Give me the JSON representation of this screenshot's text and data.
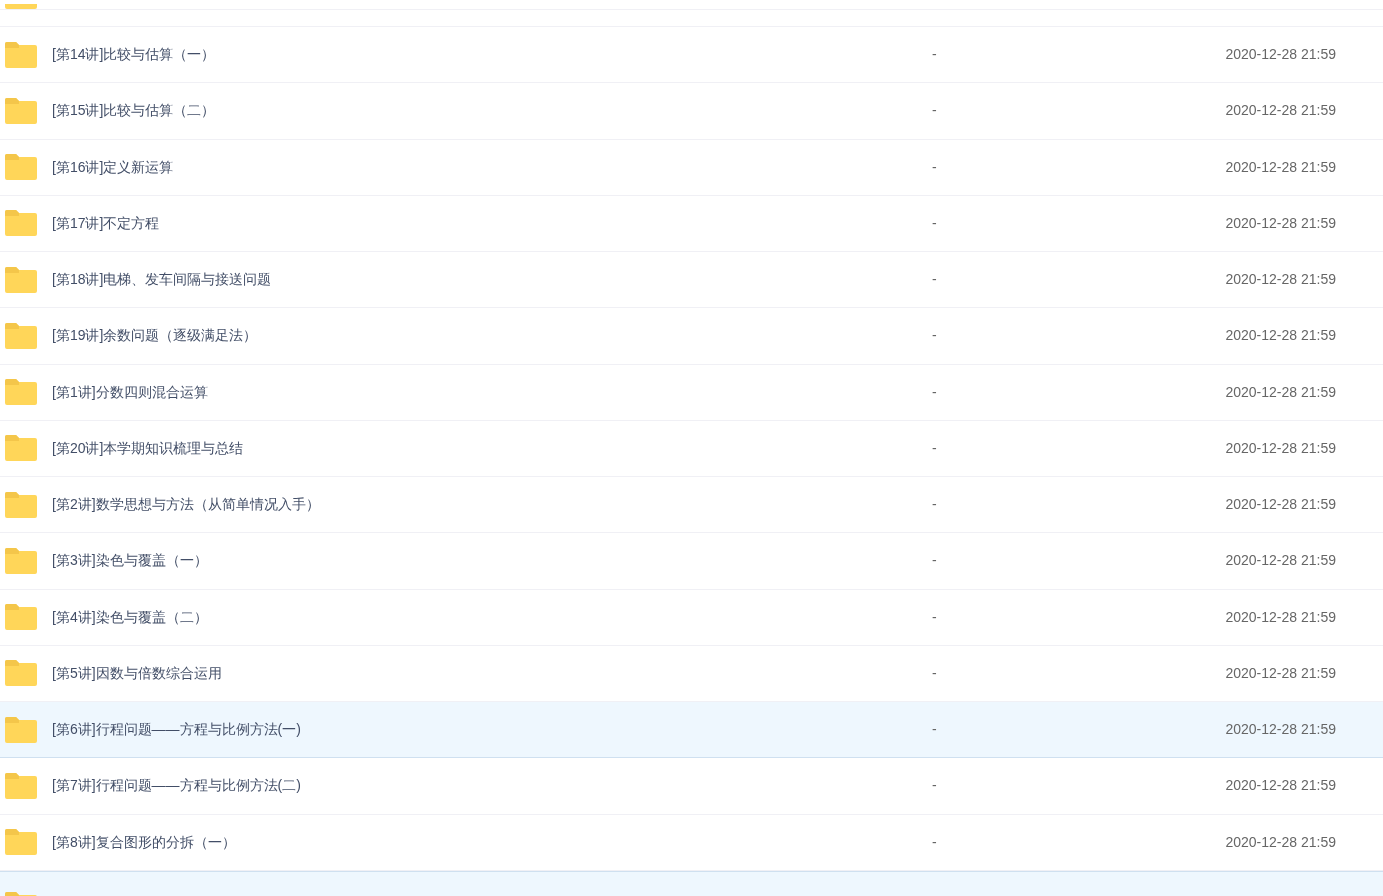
{
  "rows": [
    {
      "kind": "clipped",
      "selected": false
    },
    {
      "kind": "folder",
      "name": "[第14讲]比较与估算（一）",
      "size": "-",
      "modified": "2020-12-28 21:59",
      "selected": false
    },
    {
      "kind": "folder",
      "name": "[第15讲]比较与估算（二）",
      "size": "-",
      "modified": "2020-12-28 21:59",
      "selected": false
    },
    {
      "kind": "folder",
      "name": "[第16讲]定义新运算",
      "size": "-",
      "modified": "2020-12-28 21:59",
      "selected": false
    },
    {
      "kind": "folder",
      "name": "[第17讲]不定方程",
      "size": "-",
      "modified": "2020-12-28 21:59",
      "selected": false
    },
    {
      "kind": "folder",
      "name": "[第18讲]电梯、发车间隔与接送问题",
      "size": "-",
      "modified": "2020-12-28 21:59",
      "selected": false
    },
    {
      "kind": "folder",
      "name": "[第19讲]余数问题（逐级满足法）",
      "size": "-",
      "modified": "2020-12-28 21:59",
      "selected": false
    },
    {
      "kind": "folder",
      "name": "[第1讲]分数四则混合运算",
      "size": "-",
      "modified": "2020-12-28 21:59",
      "selected": false
    },
    {
      "kind": "folder",
      "name": "[第20讲]本学期知识梳理与总结",
      "size": "-",
      "modified": "2020-12-28 21:59",
      "selected": false
    },
    {
      "kind": "folder",
      "name": "[第2讲]数学思想与方法（从简单情况入手）",
      "size": "-",
      "modified": "2020-12-28 21:59",
      "selected": false
    },
    {
      "kind": "folder",
      "name": "[第3讲]染色与覆盖（一）",
      "size": "-",
      "modified": "2020-12-28 21:59",
      "selected": false
    },
    {
      "kind": "folder",
      "name": "[第4讲]染色与覆盖（二）",
      "size": "-",
      "modified": "2020-12-28 21:59",
      "selected": false
    },
    {
      "kind": "folder",
      "name": "[第5讲]因数与倍数综合运用",
      "size": "-",
      "modified": "2020-12-28 21:59",
      "selected": false
    },
    {
      "kind": "folder",
      "name": "[第6讲]行程问题——方程与比例方法(一)",
      "size": "-",
      "modified": "2020-12-28 21:59",
      "selected": true
    },
    {
      "kind": "folder",
      "name": "[第7讲]行程问题——方程与比例方法(二)",
      "size": "-",
      "modified": "2020-12-28 21:59",
      "selected": false
    },
    {
      "kind": "folder",
      "name": "[第8讲]复合图形的分拆（一）",
      "size": "-",
      "modified": "2020-12-28 21:59",
      "selected": false
    },
    {
      "kind": "clipped",
      "selected": true
    }
  ]
}
